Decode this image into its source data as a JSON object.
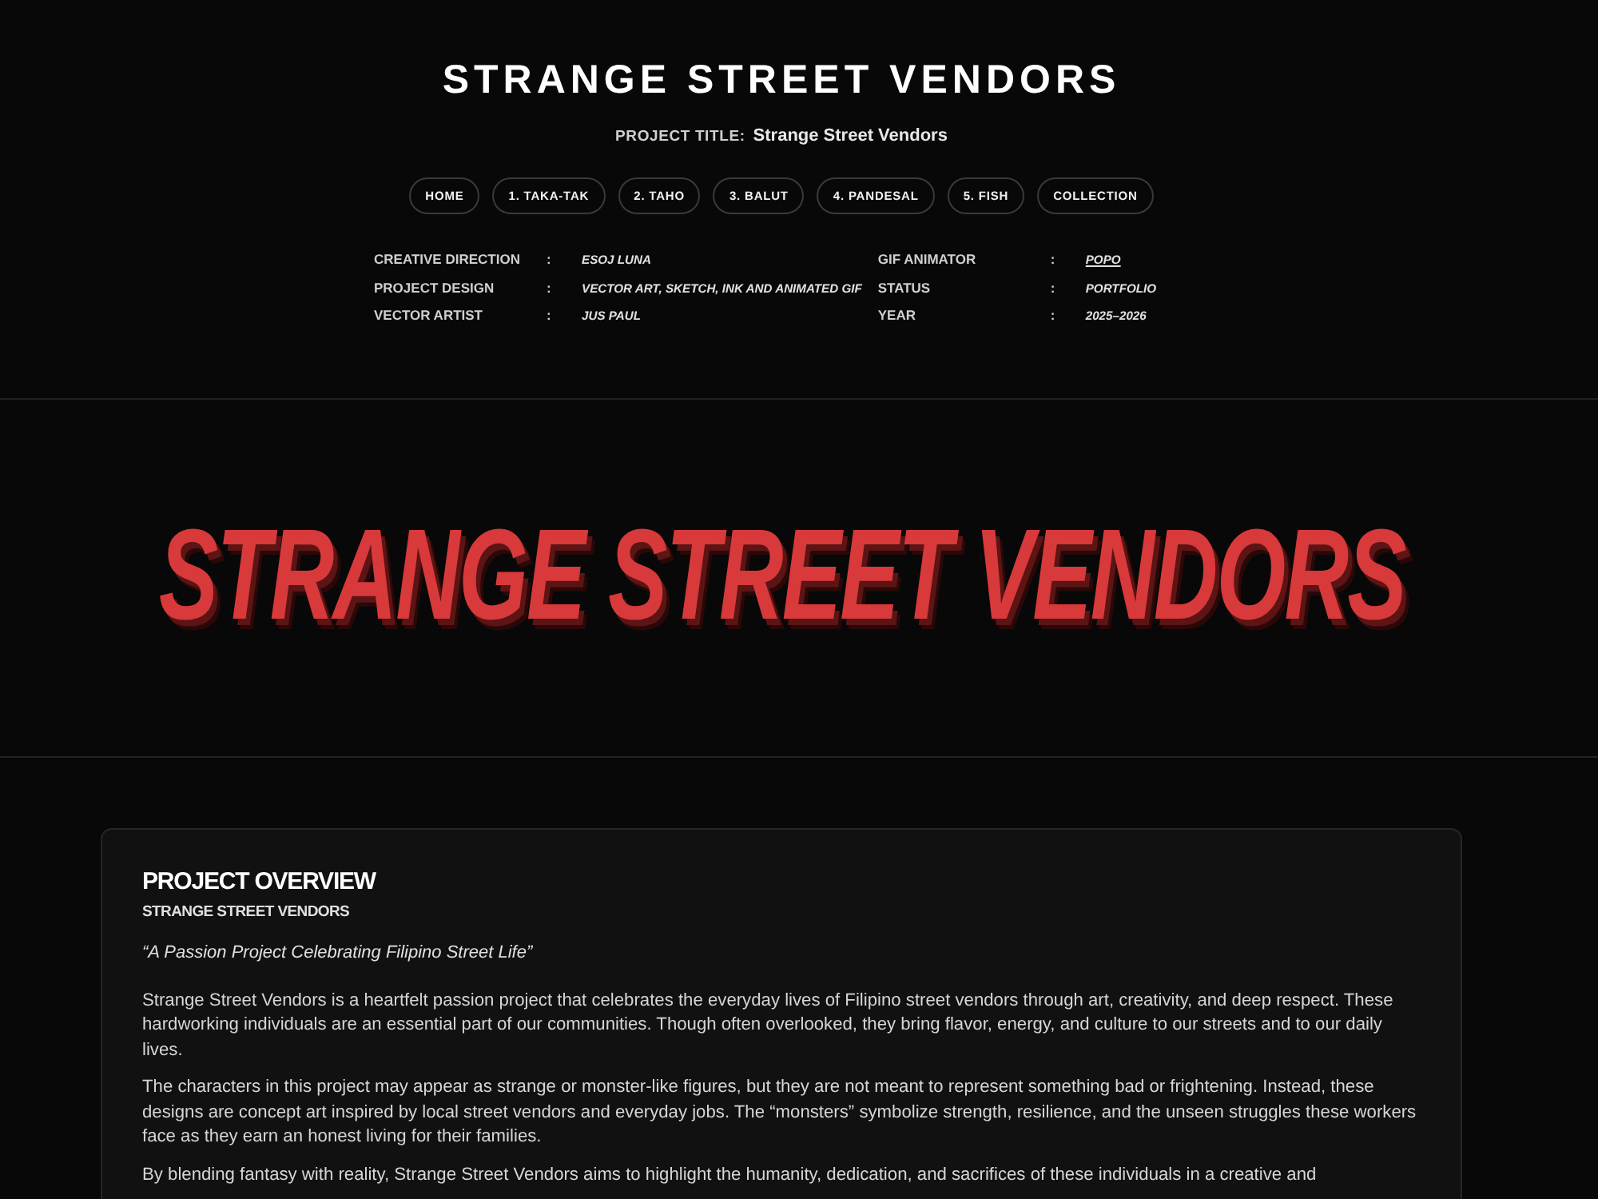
{
  "header": {
    "title": "STRANGE STREET VENDORS",
    "project_title_label": "PROJECT TITLE:",
    "project_title": "Strange Street Vendors"
  },
  "nav": [
    {
      "label": "HOME"
    },
    {
      "label": "1. TAKA-TAK"
    },
    {
      "label": "2. TAHO"
    },
    {
      "label": "3. BALUT"
    },
    {
      "label": "4. PANDESAL"
    },
    {
      "label": "5. FISH"
    },
    {
      "label": "COLLECTION"
    }
  ],
  "credits": [
    [
      {
        "label": "CREATIVE DIRECTION",
        "separator": ":",
        "value": "ESOJ LUNA",
        "kind": "text"
      },
      {
        "label": "PROJECT DESIGN",
        "separator": ":",
        "value": "VECTOR ART, SKETCH, INK AND ANIMATED GIF",
        "kind": "text"
      },
      {
        "label": "VECTOR ARTIST",
        "separator": ":",
        "value": "JUS PAUL",
        "kind": "text"
      }
    ],
    [
      {
        "label": "GIF ANIMATOR",
        "separator": ":",
        "value": "POPO",
        "kind": "link"
      },
      {
        "label": "STATUS",
        "separator": ":",
        "value": "PORTFOLIO",
        "kind": "text"
      },
      {
        "label": "YEAR",
        "separator": ":",
        "value": "2025–2026",
        "kind": "text"
      }
    ]
  ],
  "banner": {
    "logo_text": "STRANGE STREET VENDORS"
  },
  "overview": {
    "heading": "PROJECT OVERVIEW",
    "subheading": "STRANGE STREET VENDORS",
    "tagline": "“A Passion Project Celebrating Filipino Street Life”",
    "paragraphs": [
      "Strange Street Vendors is a heartfelt passion project that celebrates the everyday lives of Filipino street vendors through art, creativity, and deep respect. These hardworking individuals are an essential part of our communities. Though often overlooked, they bring flavor, energy, and culture to our streets and to our daily lives.",
      "The characters in this project may appear as strange or monster-like figures, but they are not meant to represent something bad or frightening. Instead, these designs are concept art inspired by local street vendors and everyday jobs. The “monsters” symbolize strength, resilience, and the unseen struggles these workers face as they earn an honest living for their families.",
      "By blending fantasy with reality, Strange Street Vendors aims to highlight the humanity, dedication, and sacrifices of these individuals in a creative and"
    ]
  }
}
